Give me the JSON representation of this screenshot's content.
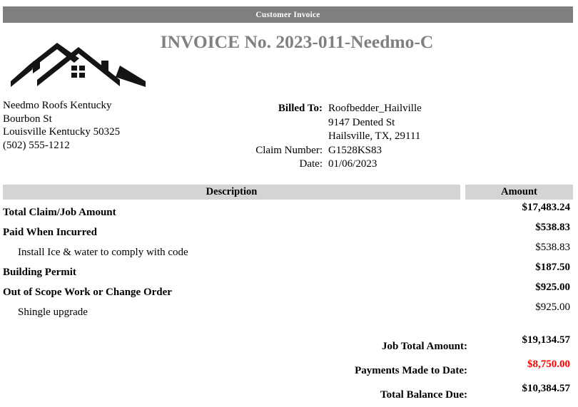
{
  "banner": {
    "title": "Customer Invoice",
    "background_color": "#7f7f7f",
    "text_color": "#ffffff"
  },
  "header": {
    "invoice_title": "INVOICE No. 2023-011-Needmo-C",
    "title_color": "#808080",
    "logo_icon": "roof-house-logo-icon"
  },
  "company": {
    "name": "Needmo Roofs Kentucky",
    "street": "Bourbon St",
    "city_state_zip": "Louisville Kentucky 50325",
    "phone": "(502) 555-1212"
  },
  "bill_to": {
    "label": "Billed To:",
    "name": "Roofbedder_Hailville",
    "street": "9147 Dented St",
    "city_state_zip": "Hailsville, TX, 29111",
    "claim_number_label": "Claim Number:",
    "claim_number": "G1528KS83",
    "date_label": "Date:",
    "date": "01/06/2023"
  },
  "table": {
    "header_background": "#d4d4d4",
    "columns": [
      "Description",
      "Amount"
    ],
    "rows": [
      {
        "type": "section",
        "description": "Total Claim/Job Amount",
        "amount": "$17,483.24"
      },
      {
        "type": "section",
        "description": "Paid When Incurred",
        "amount": "$538.83"
      },
      {
        "type": "item",
        "description": "Install Ice & water to comply with code",
        "amount": "$538.83"
      },
      {
        "type": "section",
        "description": "Building Permit",
        "amount": "$187.50"
      },
      {
        "type": "section",
        "description": "Out of Scope Work or Change Order",
        "amount": "$925.00"
      },
      {
        "type": "item",
        "description": "Shingle upgrade",
        "amount": "$925.00"
      }
    ]
  },
  "totals": [
    {
      "label": "Job Total Amount:",
      "amount": "$19,134.57",
      "color": "#000000"
    },
    {
      "label": "Payments Made to Date:",
      "amount": "$8,750.00",
      "color": "#ff0000"
    },
    {
      "label": "Total Balance Due:",
      "amount": "$10,384.57",
      "color": "#000000"
    }
  ]
}
